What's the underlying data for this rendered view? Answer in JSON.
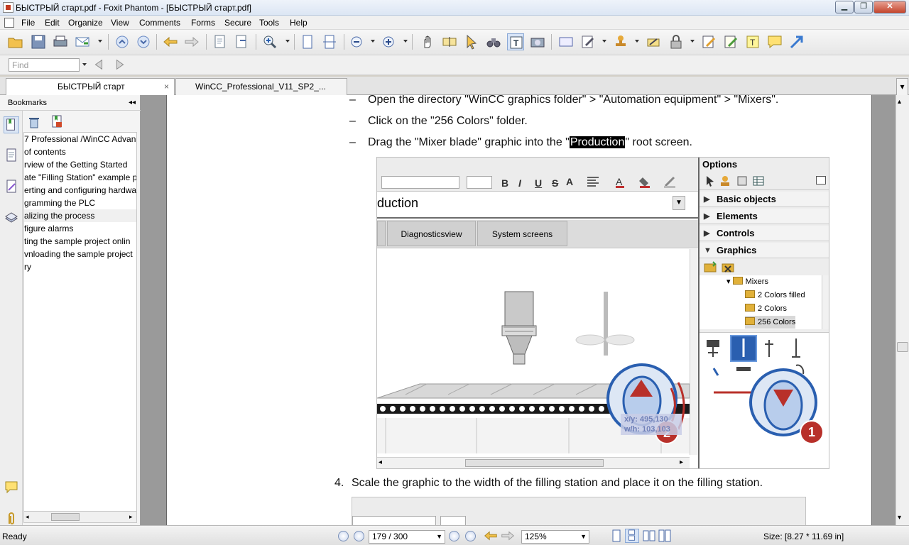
{
  "window": {
    "title": "БЫСТРЫЙ старт.pdf - Foxit Phantom - [БЫСТРЫЙ старт.pdf]",
    "minimize": "▁",
    "restore": "❐",
    "close": "✕"
  },
  "menu": [
    "File",
    "Edit",
    "Organize",
    "View",
    "Comments",
    "Forms",
    "Secure",
    "Tools",
    "Help"
  ],
  "find": {
    "placeholder": "Find"
  },
  "tabs": [
    {
      "label": "БЫСТРЫЙ старт",
      "active": true,
      "close": "×"
    },
    {
      "label": "WinCC_Professional_V11_SP2_...",
      "active": false
    }
  ],
  "tab_overflow": "▾",
  "left_panel": {
    "header": "Bookmarks",
    "collapse": "◂◂",
    "bookmarks": [
      "7 Professional /WinCC Advan",
      " of contents",
      "rview of the Getting Started",
      "ate \"Filling Station\" example p",
      "erting and configuring hardwa",
      "gramming the PLC",
      "alizing the process",
      "figure alarms",
      "ting the sample project onlin",
      "vnloading the sample project",
      "ry"
    ],
    "selected_index": 6
  },
  "document": {
    "bullet": "–",
    "line1": "Open the directory \"WinCC graphics folder\" > \"Automation equipment\" > \"Mixers\".",
    "line2": "Click on the \"256 Colors\" folder.",
    "line3_pre": "Drag the \"Mixer blade\" graphic into the \"",
    "line3_hl": "Production",
    "line3_post": "\" root screen.",
    "step4_num": "4.",
    "step4": "Scale the graphic to the width of the filling station and place it on the filling station."
  },
  "screenshot": {
    "title": "duction",
    "tabs": [
      "Diagnosticsview",
      "System screens"
    ],
    "coords": {
      "xy_label": "x/y:",
      "xy": "495,130",
      "wh_label": "w/h:",
      "wh": "103,103"
    },
    "options_header": "Options",
    "sections": [
      "Basic objects",
      "Elements",
      "Controls",
      "Graphics"
    ],
    "tree": [
      "Mixers",
      "2 Colors filled",
      "2 Colors",
      "256 Colors"
    ],
    "tree_selected": 3,
    "callouts": [
      "2",
      "1"
    ],
    "fmt_buttons": [
      "B",
      "I",
      "U",
      "S"
    ]
  },
  "status": {
    "ready": "Ready",
    "page": "179 / 300",
    "zoom": "125%",
    "size": "Size: [8.27 * 11.69 in]"
  },
  "colors": {
    "highlight": "#000000",
    "callout_blue": "#2a5fb0",
    "callout_red": "#b8302a"
  }
}
